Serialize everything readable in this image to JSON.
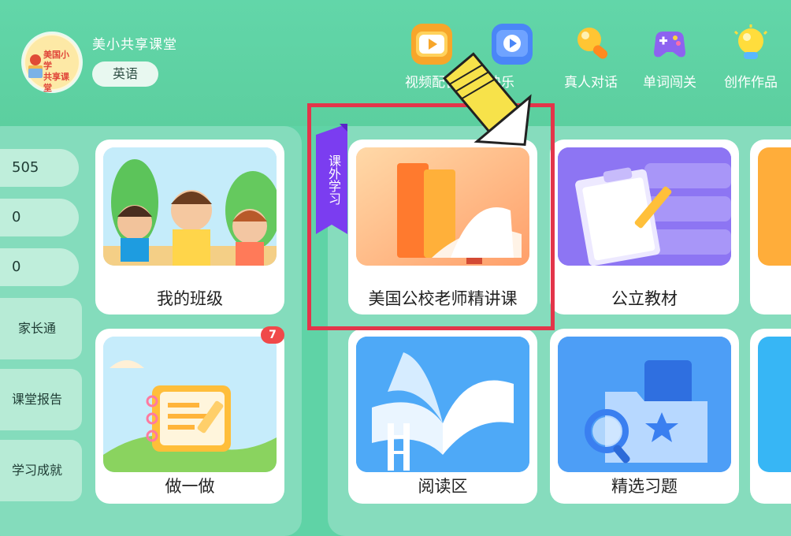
{
  "profile": {
    "school_name": "美小共享课堂",
    "subject": "英语",
    "avatar_text": "美国小学\n共享课堂"
  },
  "top_nav": [
    {
      "label": "视频配音",
      "icon": "video-dub-icon",
      "color": "#f5a623"
    },
    {
      "label": "快乐",
      "icon": "play-video-icon",
      "color": "#4a86f7"
    },
    {
      "label": "真人对话",
      "icon": "microphone-icon",
      "color": "#ffb52b"
    },
    {
      "label": "单词闯关",
      "icon": "gamepad-icon",
      "color": "#8d63f0"
    },
    {
      "label": "创作作品",
      "icon": "lightbulb-icon",
      "color": "#ffd43b"
    }
  ],
  "stats": [
    "505",
    "0",
    "0"
  ],
  "side_buttons": [
    "家长通",
    "课堂报告",
    "学习成就"
  ],
  "left_cards": [
    {
      "label": "我的班级"
    },
    {
      "label": "做一做",
      "badge": "7"
    }
  ],
  "ribbon": {
    "text": "课外学习",
    "color": "#7b3df0"
  },
  "right_cards": [
    {
      "label": "美国公校老师精讲课"
    },
    {
      "label": "公立教材"
    },
    {
      "label": "阅读区"
    },
    {
      "label": "精选习题"
    }
  ],
  "colors": {
    "background": "#5fd3a6",
    "highlight": "#e3354a",
    "badge": "#f04949"
  }
}
